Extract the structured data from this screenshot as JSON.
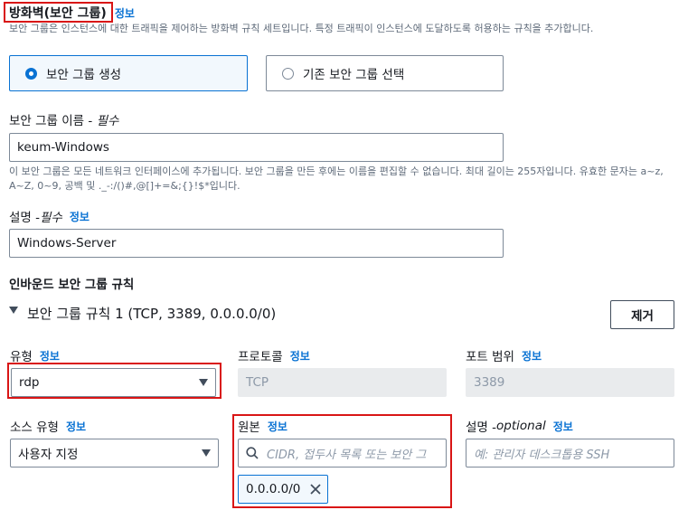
{
  "section": {
    "title": "방화벽(보안 그룹)",
    "info": "정보",
    "description": "보안 그룹은 인스턴스에 대한 트래픽을 제어하는 방화벽 규칙 세트입니다. 특정 트래픽이 인스턴스에 도달하도록 허용하는 규칙을 추가합니다."
  },
  "options": {
    "create": "보안 그룹 생성",
    "existing": "기존 보안 그룹 선택",
    "selected": "create"
  },
  "sg_name": {
    "label": "보안 그룹 이름 - ",
    "required": "필수",
    "value": "keum-Windows",
    "hint": "이 보안 그룹은 모든 네트워크 인터페이스에 추가됩니다. 보안 그룹을 만든 후에는 이름을 편집할 수 없습니다. 최대 길이는 255자입니다. 유효한 문자는 a~z, A~Z, 0~9, 공백 및 ._-:/()#,@[]+=&;{}!$*입니다."
  },
  "sg_desc": {
    "label": "설명 - ",
    "required": "필수",
    "info": "정보",
    "value": "Windows-Server"
  },
  "inbound": {
    "title": "인바운드 보안 그룹 규칙",
    "rule_title": "보안 그룹 규칙 1 (TCP, 3389, 0.0.0.0/0)",
    "remove": "제거"
  },
  "rule": {
    "type_label": "유형",
    "type_info": "정보",
    "type_value": "rdp",
    "protocol_label": "프로토콜",
    "protocol_info": "정보",
    "protocol_value": "TCP",
    "port_label": "포트 범위",
    "port_info": "정보",
    "port_value": "3389",
    "source_type_label": "소스 유형",
    "source_type_info": "정보",
    "source_type_value": "사용자 지정",
    "source_label": "원본",
    "source_info": "정보",
    "source_placeholder": "CIDR, 접두사 목록 또는 보안 그",
    "source_token": "0.0.0.0/0",
    "desc_label": "설명 - ",
    "desc_optional": "optional",
    "desc_info": "정보",
    "desc_placeholder": "예: 관리자 데스크톱용 SSH"
  },
  "colors": {
    "link": "#0972d3",
    "highlight": "#d91515",
    "selected_bg": "#f2f8fd"
  }
}
